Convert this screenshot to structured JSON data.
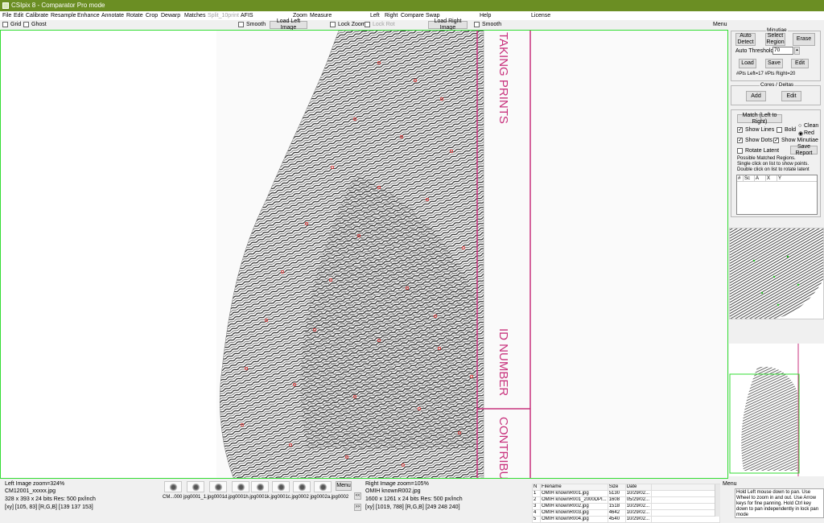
{
  "window": {
    "title": "CSIpix 8 - Comparator Pro mode"
  },
  "menu": {
    "file": "File",
    "edit": "Edit",
    "calibrate": "Calibrate",
    "resample": "Resample",
    "enhance": "Enhance",
    "annotate": "Annotate",
    "rotate": "Rotate",
    "crop": "Crop",
    "dewarp": "Dewarp",
    "matches": "Matches",
    "split": "Split_10print",
    "afis": "AFIS",
    "zoom": "Zoom",
    "measure": "Measure",
    "left": "Left",
    "right": "Right",
    "compare": "Compare",
    "swap": "Swap",
    "help": "Help",
    "license": "License"
  },
  "toolbar": {
    "grid": "Grid",
    "ghost": "Ghost",
    "smooth_left": "Smooth",
    "load_left": "Load Left Image",
    "lock_zoom": "Lock Zoom",
    "lock_rot": "Lock Rot",
    "load_right": "Load Right Image",
    "smooth_right": "Smooth",
    "menu": "Menu"
  },
  "minutiae": {
    "title": "Minutiae",
    "auto_detect": "Auto Detect",
    "select_region": "Select Region",
    "erase": "Erase",
    "auto_threshold_label": "Auto Threshold",
    "threshold": "70",
    "load": "Load",
    "save": "Save",
    "edit": "Edit",
    "counts": "#Pts Left=17   #Pts Right=20"
  },
  "cores": {
    "title": "Cores / Deltas",
    "add": "Add",
    "edit": "Edit"
  },
  "match": {
    "button": "Match (Left to Right)",
    "show_lines": "Show Lines",
    "bold": "Bold",
    "clean": "Clean",
    "red": "Red",
    "show_dots": "Show Dots",
    "show_minutiae": "Show Minutiae",
    "rotate_latent": "Rotate Latent",
    "save_report": "Save Report",
    "hint1": "Possible Matched Regions.",
    "hint2": "Single click on list to show points.",
    "hint3": "Double click on list to rotate latent",
    "columns": [
      "#",
      "Sc",
      "A",
      "X",
      "Y"
    ]
  },
  "viewer": {
    "label1": "TAKING PRINTS",
    "label2": "ID NUMBER",
    "label3": "CONTRIBUT"
  },
  "left_info": {
    "header": "Left Image  zoom=324%",
    "file": "CM12001_xxxxx.jpg",
    "dims": "328 x 393 x 24 bits    Res: 500 px/inch",
    "coords": "[xy] [105, 83]   [R,G,B] [139 137 153]"
  },
  "right_info": {
    "header": "Right Image  zoom=105%",
    "file": "OMIH knownR002.jpg",
    "dims": "1600 x 1261 x 24 bits    Res: 500 px/inch",
    "coords": "[xy] [1019, 788]   [R,G,B] [249 248 240]"
  },
  "filmstrip": {
    "labels": "CM...000   jpg0001_1.jpg0001d.jpg0001h.jpg0001k.jpg0001c.jpg0002 jpg0002a.jpg0002",
    "menu": "Menu",
    "prev": "<<",
    "next": ">>"
  },
  "file_list": {
    "columns": [
      "N",
      "Filename",
      "Size",
      "Date"
    ],
    "rows": [
      [
        "1",
        "OMIH knownR001.jpg",
        "5130",
        "10/29/02..."
      ],
      [
        "2",
        "OMIH knownR001_2000DPI...",
        "1608",
        "05/29/02..."
      ],
      [
        "3",
        "OMIH knownR002.jpg",
        "1518",
        "10/29/02..."
      ],
      [
        "4",
        "OMIH knownR003.jpg",
        "4642",
        "10/29/02..."
      ],
      [
        "5",
        "OMIH knownR004.jpg",
        "4540",
        "10/29/02..."
      ]
    ],
    "menu": "Menu"
  },
  "notes": "Hold Left mouse down to pan. Use Wheel to zoom in and out. Use Arrow keys for fine panning. Hold Ctrl key down to pan independently in lock pan mode",
  "colors": {
    "title_bar": "#6b8e23",
    "viewer_border": "#33dd33",
    "pink_line": "#c8327d",
    "minutiae_red": "#e23c3c",
    "minutiae_green": "#22bb22"
  }
}
